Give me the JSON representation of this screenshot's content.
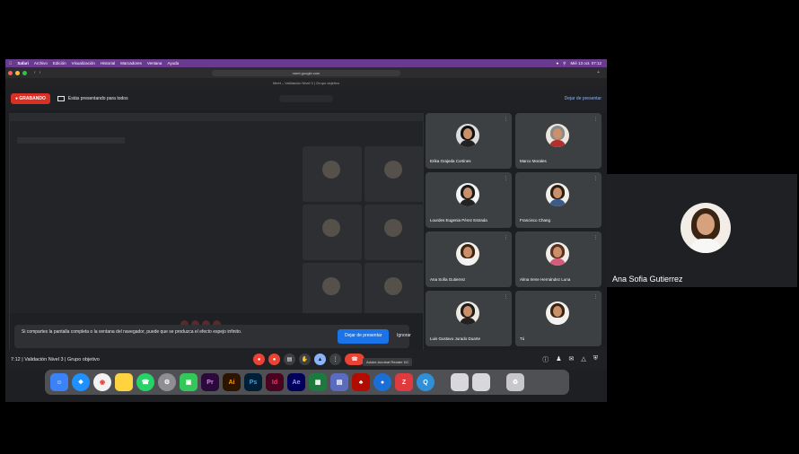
{
  "menubar": {
    "app": "Safari",
    "items": [
      "Archivo",
      "Edición",
      "Visualización",
      "Historial",
      "Marcadores",
      "Ventana",
      "Ayuda"
    ],
    "clock": "Mié 13 oct. 07:12"
  },
  "browser": {
    "url": "meet.google.com",
    "tab_title": "Meet – Validación Nivel 3 | Grupo objetivo"
  },
  "meet_top": {
    "recording_label": "GRABANDO",
    "presenting_label": "Estás presentando para todos",
    "stop_presenting": "Dejar de presentar"
  },
  "participants": [
    {
      "name": "Erika Grajeda Cortines"
    },
    {
      "name": "Marco Morales"
    },
    {
      "name": "Lourdes Eugenia Pérez Estrada"
    },
    {
      "name": "Francisco Chang"
    },
    {
      "name": "Ana Sofia Gutierrez"
    },
    {
      "name": "Alma Irene Hernández Luna"
    },
    {
      "name": "Luis Gustavo Jurado Duarte"
    },
    {
      "name": "Tú"
    }
  ],
  "toast": {
    "message": "Si compartes la pantalla completa o la ventana del navegador, puede que se produzca el efecto espejo infinito.",
    "stop_button": "Dejar de presentar",
    "ignore_button": "Ignorar"
  },
  "meet_bottom": {
    "meeting_label": "7:12 | Validación Nivel 3 | Grupo objetivo"
  },
  "dock_tooltip": "Adobe Acrobat Reader DC",
  "dock_apps": [
    "Pr",
    "Ai",
    "Ps",
    "Id",
    "Ae"
  ],
  "side_tile": {
    "name": "Ana Sofia Gutierrez"
  }
}
